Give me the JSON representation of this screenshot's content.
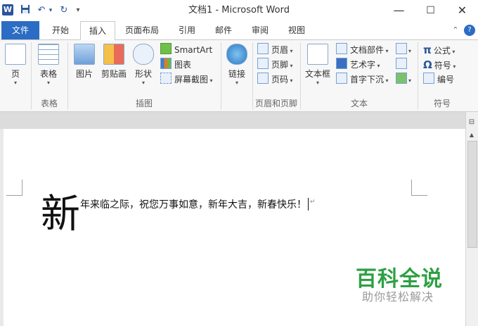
{
  "titlebar": {
    "title": "文档1 - Microsoft Word",
    "logo_letter": "W",
    "undo": "↶",
    "redo": "↻",
    "qa_more": "▾"
  },
  "window_controls": {
    "minimize": "—",
    "maximize": "☐",
    "close": "✕"
  },
  "tabs": [
    {
      "label": "文件"
    },
    {
      "label": "开始"
    },
    {
      "label": "插入"
    },
    {
      "label": "页面布局"
    },
    {
      "label": "引用"
    },
    {
      "label": "邮件"
    },
    {
      "label": "审阅"
    },
    {
      "label": "视图"
    }
  ],
  "ribbon_right": {
    "collapse": "⌃",
    "help": "?"
  },
  "ribbon": {
    "pages": {
      "label": "页",
      "group": ""
    },
    "tables": {
      "label": "表格",
      "group": "表格"
    },
    "illustrations": {
      "group": "插图",
      "picture": "图片",
      "clipart": "剪贴画",
      "shapes": "形状",
      "smartart": "SmartArt",
      "chart": "图表",
      "screenshot": "屏幕截图"
    },
    "links": {
      "label": "链接"
    },
    "header_footer": {
      "group": "页眉和页脚",
      "header": "页眉",
      "footer": "页脚",
      "page_number": "页码"
    },
    "text": {
      "group": "文本",
      "textbox": "文本框",
      "quick_parts": "文档部件",
      "wordart": "艺术字",
      "dropcap": "首字下沉"
    },
    "symbols": {
      "group": "符号",
      "equation": "公式",
      "symbol": "符号",
      "number": "编号",
      "equation_glyph": "π",
      "symbol_glyph": "Ω"
    }
  },
  "document": {
    "dropcap_char": "新",
    "line": "年来临之际，祝您万事如意，新年大吉，新春快乐！",
    "paragraph_mark": "↵"
  },
  "watermark": {
    "title": "百科全说",
    "subtitle": "助你轻松解决"
  }
}
